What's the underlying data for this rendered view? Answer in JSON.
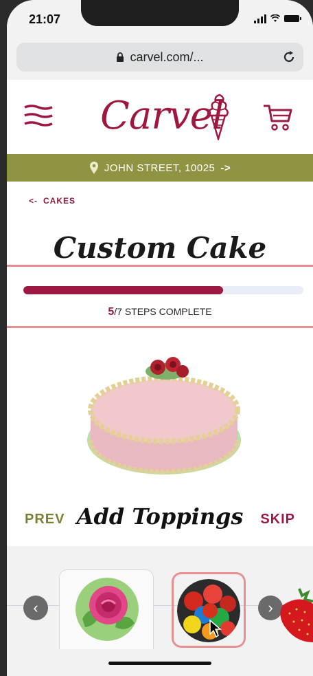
{
  "status": {
    "time": "21:07"
  },
  "browser": {
    "url": "carvel.com/..."
  },
  "brand": {
    "logo_text": "Carvel",
    "color": "#a0173e"
  },
  "location": {
    "label": "JOHN STREET, 10025",
    "arrow": "->"
  },
  "nav": {
    "back_arrow": "<-",
    "back_label": "CAKES"
  },
  "page": {
    "title": "Custom Cake"
  },
  "progress": {
    "current": "5",
    "total_text": "/7",
    "suffix": " STEPS COMPLETE",
    "fraction": 0.714
  },
  "step": {
    "prev": "PREV",
    "title": "Add Toppings",
    "skip": "SKIP"
  },
  "toppings": [
    {
      "name": "rose frosting",
      "selected": false
    },
    {
      "name": "m&m candies",
      "selected": true
    },
    {
      "name": "strawberry",
      "selected": false
    }
  ],
  "colors": {
    "accent": "#9c1a42",
    "location_bar": "#8f9442",
    "prev": "#7d7f36"
  }
}
